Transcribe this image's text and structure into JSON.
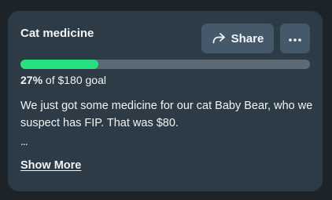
{
  "campaign": {
    "title": "Cat medicine",
    "progress": {
      "percent_label": "27%",
      "goal_label": "of $180 goal",
      "fraction": 0.27
    },
    "description": "We just got some medicine for our cat Baby Bear, who we suspect has FIP. That was $80.",
    "ellipsis": "...",
    "show_more_label": "Show More"
  },
  "actions": {
    "share_label": "Share",
    "share_icon": "share-arrow-icon",
    "more_icon": "more-horizontal-icon"
  },
  "colors": {
    "page_background": "#1c2329",
    "card_background": "#2c3b45",
    "button_background": "#45596a",
    "progress_fill": "#27e07f",
    "progress_track": "#5d6a73",
    "text": "#f1f4f6"
  }
}
